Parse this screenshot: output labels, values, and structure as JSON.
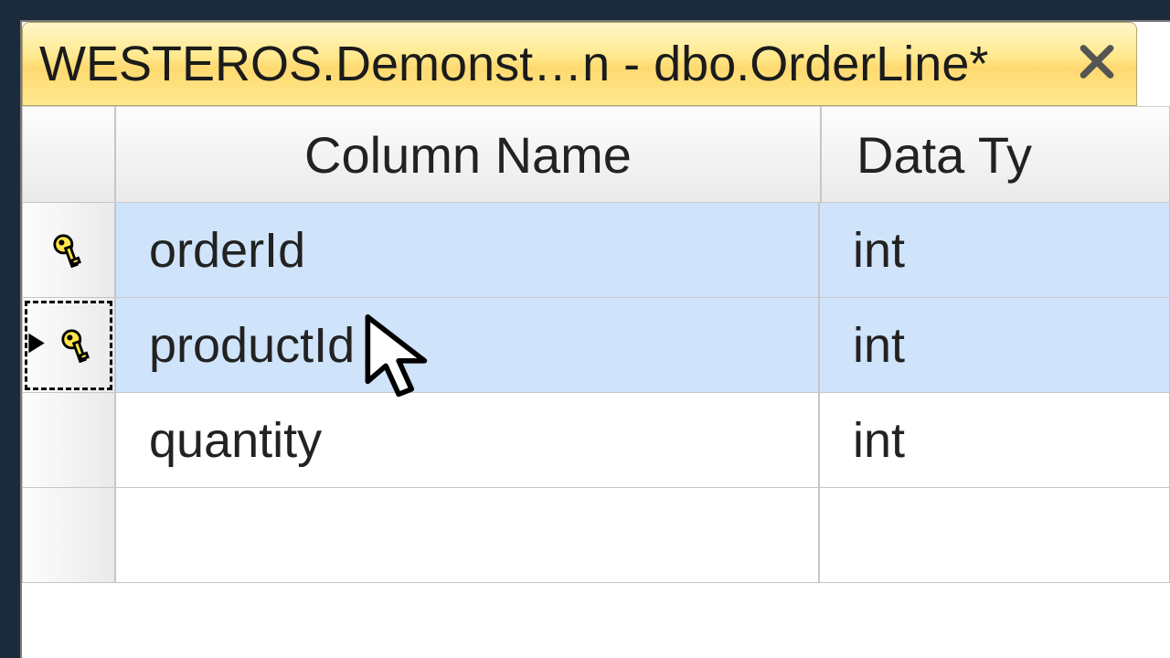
{
  "tab": {
    "title": "WESTEROS.Demonst…n - dbo.OrderLine*"
  },
  "headers": {
    "col1": "Column Name",
    "col2": "Data Ty"
  },
  "rows": [
    {
      "name": "orderId",
      "type": "int",
      "pk": true,
      "selected": true,
      "current": false
    },
    {
      "name": "productId",
      "type": "int",
      "pk": true,
      "selected": true,
      "current": true
    },
    {
      "name": "quantity",
      "type": "int",
      "pk": false,
      "selected": false,
      "current": false
    },
    {
      "name": "",
      "type": "",
      "pk": false,
      "selected": false,
      "current": false
    }
  ]
}
